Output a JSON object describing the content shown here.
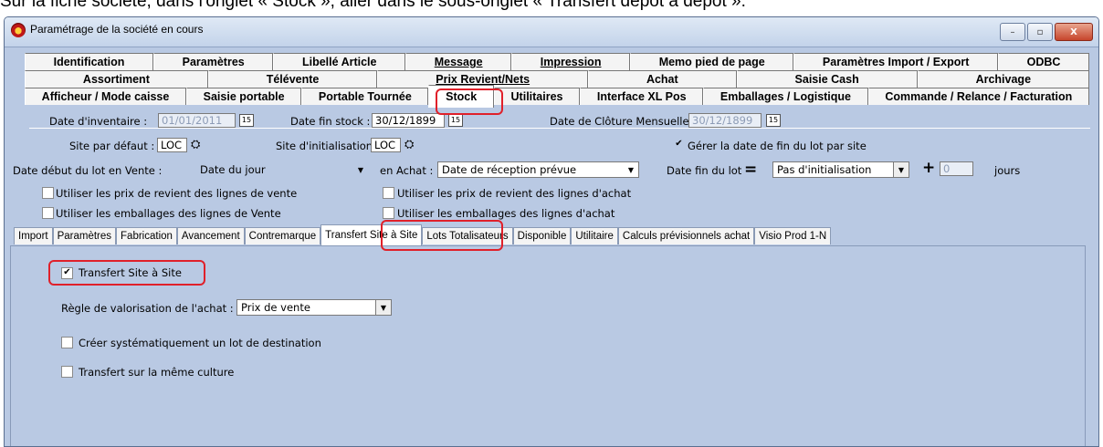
{
  "caption": "Sur la fiche société, dans l'onglet « Stock », aller dans le sous-onglet « Transfert dépôt à dépôt ».",
  "window": {
    "title": "Paramétrage de la société en cours",
    "minimize": "–",
    "maximize": "▫",
    "close": "X"
  },
  "tabs": {
    "row1": [
      "Identification",
      "Paramètres",
      "Libellé Article",
      "Message",
      "Impression",
      "Memo pied de page",
      "Paramètres Import / Export",
      "ODBC"
    ],
    "row2": [
      "Assortiment",
      "Télévente",
      "Prix Revient/Nets",
      "Achat",
      "Saisie Cash",
      "Archivage"
    ],
    "row3": [
      "Afficheur / Mode caisse",
      "Saisie portable",
      "Portable Tournée",
      "Stock",
      "Utilitaires",
      "Interface XL Pos",
      "Emballages / Logistique",
      "Commande / Relance / Facturation"
    ]
  },
  "fields": {
    "date_inventaire_label": "Date d'inventaire :",
    "date_inventaire_value": "01/01/2011",
    "date_fin_stock_label": "Date fin stock :",
    "date_fin_stock_value": "30/12/1899",
    "date_cloture_label": "Date de Clôture Mensuelle :",
    "date_cloture_value": "30/12/1899",
    "site_defaut_label": "Site par défaut :",
    "site_defaut_value": "LOC",
    "site_init_label": "Site d'initialisation :",
    "site_init_value": "LOC",
    "gerer_date_fin_label": "Gérer la date de fin du lot par site",
    "date_debut_vente_label": "Date début du lot en Vente :",
    "date_debut_vente_value": "Date du jour",
    "en_achat_label": "en Achat :",
    "en_achat_value": "Date de réception prévue",
    "date_fin_lot_label": "Date fin du lot",
    "equals": "=",
    "date_fin_lot_value": "Pas d'initialisation",
    "plus": "+",
    "jours_value": "0",
    "jours_label": "jours",
    "prix_revient_vente": "Utiliser les prix de revient des lignes de vente",
    "prix_revient_achat": "Utiliser les prix de revient des lignes d'achat",
    "emballages_vente": "Utiliser les emballages des lignes de Vente",
    "emballages_achat": "Utiliser les emballages des lignes d'achat"
  },
  "subtabs": [
    "Import",
    "Paramètres",
    "Fabrication",
    "Avancement",
    "Contremarque",
    "Transfert Site à Site",
    "Lots Totalisateurs",
    "Disponible",
    "Utilitaire",
    "Calculs prévisionnels achat",
    "Visio Prod 1-N"
  ],
  "transfert": {
    "transfert_site_label": "Transfert Site à Site",
    "regle_label": "Règle de valorisation de l'achat :",
    "regle_value": "Prix de vente",
    "creer_lot_label": "Créer systématiquement un lot de destination",
    "meme_culture_label": "Transfert sur la même culture"
  },
  "glyphs": {
    "check": "✔",
    "arrow": "▼",
    "cal": "15",
    "gear": "⛭"
  }
}
